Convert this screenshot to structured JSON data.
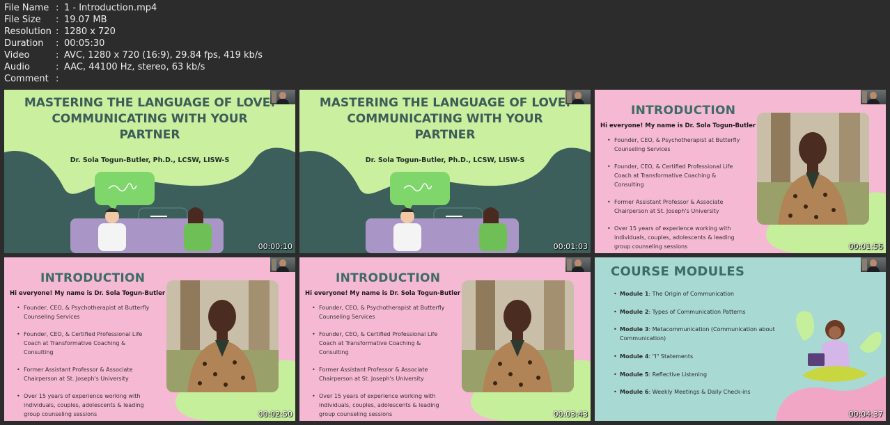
{
  "metadata": [
    {
      "key": "File Name",
      "value": "1 - Introduction.mp4"
    },
    {
      "key": "File Size",
      "value": "19.07 MB"
    },
    {
      "key": "Resolution",
      "value": "1280 x 720"
    },
    {
      "key": "Duration",
      "value": "00:05:30"
    },
    {
      "key": "Video",
      "value": "AVC, 1280 x 720 (16:9), 29.84 fps, 419 kb/s"
    },
    {
      "key": "Audio",
      "value": "AAC, 44100 Hz, stereo, 63 kb/s"
    },
    {
      "key": "Comment",
      "value": ""
    }
  ],
  "separator": ":",
  "title_slide": {
    "title_lines": [
      "MASTERING THE LANGUAGE OF LOVE:",
      "COMMUNICATING WITH YOUR",
      "PARTNER"
    ],
    "author": "Dr. Sola Togun-Butler, Ph.D., LCSW, LISW-S"
  },
  "intro_slide": {
    "heading": "INTRODUCTION",
    "greeting": "Hi everyone! My name is Dr. Sola Togun-Butler",
    "bullets": [
      "Founder, CEO, & Psychotherapist at Butterfly Counseling Services",
      "Founder, CEO, & Certified Professional Life Coach at Transformative Coaching & Consulting",
      "Former Assistant Professor & Associate Chairperson at St. Joseph's University",
      "Over 15 years of experience working with individuals, couples, adolescents & leading group counseling sessions"
    ]
  },
  "modules_slide": {
    "heading": "COURSE MODULES",
    "modules": [
      {
        "label": "Module 1",
        "text": "The Origin of Communication"
      },
      {
        "label": "Module 2",
        "text": "Types of Communication Patterns"
      },
      {
        "label": "Module 3",
        "text": "Metacommunication (Communication about Communication)"
      },
      {
        "label": "Module 4",
        "text": "\"I\" Statements"
      },
      {
        "label": "Module 5",
        "text": "Reflective Listening"
      },
      {
        "label": "Module 6",
        "text": "Weekly Meetings & Daily Check-ins"
      }
    ]
  },
  "thumbnails": [
    {
      "slide": "title",
      "timestamp": "00:00:10"
    },
    {
      "slide": "title",
      "timestamp": "00:01:03"
    },
    {
      "slide": "intro",
      "timestamp": "00:01:56"
    },
    {
      "slide": "intro",
      "timestamp": "00:02:50"
    },
    {
      "slide": "intro",
      "timestamp": "00:03:43"
    },
    {
      "slide": "modules",
      "timestamp": "00:04:37"
    }
  ],
  "colors": {
    "background": "#2c2c2c",
    "title_slide_bg": "#c9ef9f",
    "dark_teal": "#3c5f5c",
    "intro_slide_bg": "#f6b9d3",
    "modules_slide_bg": "#a8d9d3",
    "heading_teal": "#3d6b66"
  }
}
